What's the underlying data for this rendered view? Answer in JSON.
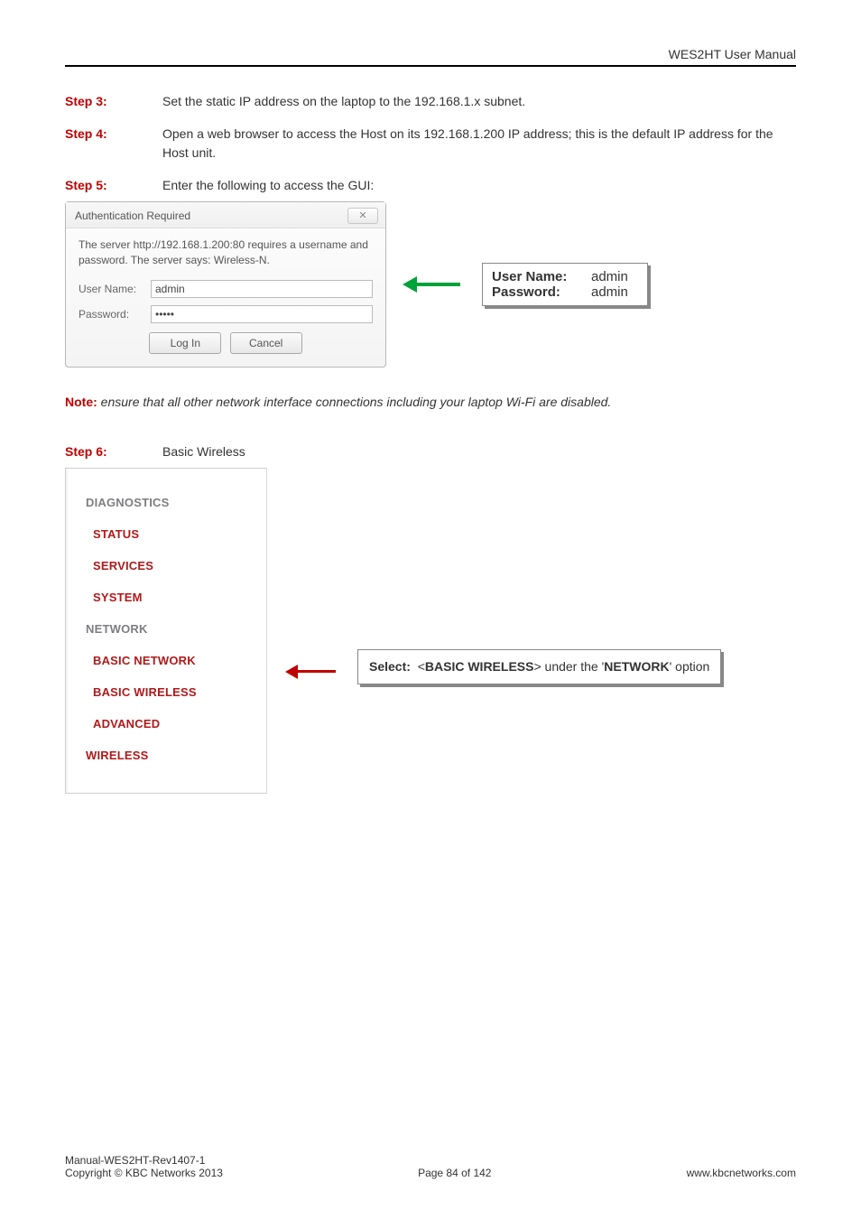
{
  "header": {
    "title": "WES2HT User Manual"
  },
  "steps": {
    "s3": {
      "label": "Step 3:",
      "text": "Set the static IP address on the laptop to the 192.168.1.x subnet."
    },
    "s4": {
      "label": "Step 4:",
      "text": "Open a web browser to access the Host on its 192.168.1.200 IP address; this is the default IP address for the Host unit."
    },
    "s5": {
      "label": "Step 5:",
      "text": "Enter the following to access the GUI:"
    },
    "s6": {
      "label": "Step 6:",
      "text": "Basic Wireless"
    }
  },
  "auth": {
    "title": "Authentication Required",
    "close": "✕",
    "message": "The server http://192.168.1.200:80 requires a username and password. The server says: Wireless-N.",
    "username_label": "User Name:",
    "username_value": "admin",
    "password_label": "Password:",
    "password_value": "•••••",
    "login_btn": "Log In",
    "cancel_btn": "Cancel"
  },
  "creds": {
    "user_key": "User Name:",
    "user_val": "admin",
    "pass_key": "Password:",
    "pass_val": "admin"
  },
  "note": {
    "label": "Note:",
    "text": " ensure that all other network interface connections including your laptop Wi-Fi are disabled."
  },
  "menu": {
    "items": [
      {
        "label": "DIAGNOSTICS"
      },
      {
        "label": "STATUS"
      },
      {
        "label": "SERVICES"
      },
      {
        "label": "SYSTEM"
      },
      {
        "label": "NETWORK"
      },
      {
        "label": "BASIC NETWORK"
      },
      {
        "label": "BASIC WIRELESS"
      },
      {
        "label": "ADVANCED"
      },
      {
        "label": "WIRELESS"
      }
    ]
  },
  "select_box": {
    "prefix": "Select:  <",
    "strong": "BASIC WIRELESS",
    "suffix": "> under the '",
    "strong2": "NETWORK",
    "suffix2": "' option"
  },
  "footer": {
    "left1": "Manual-WES2HT-Rev1407-1",
    "left2": "Copyright © KBC Networks 2013",
    "center": "Page 84 of 142",
    "right": "www.kbcnetworks.com"
  }
}
